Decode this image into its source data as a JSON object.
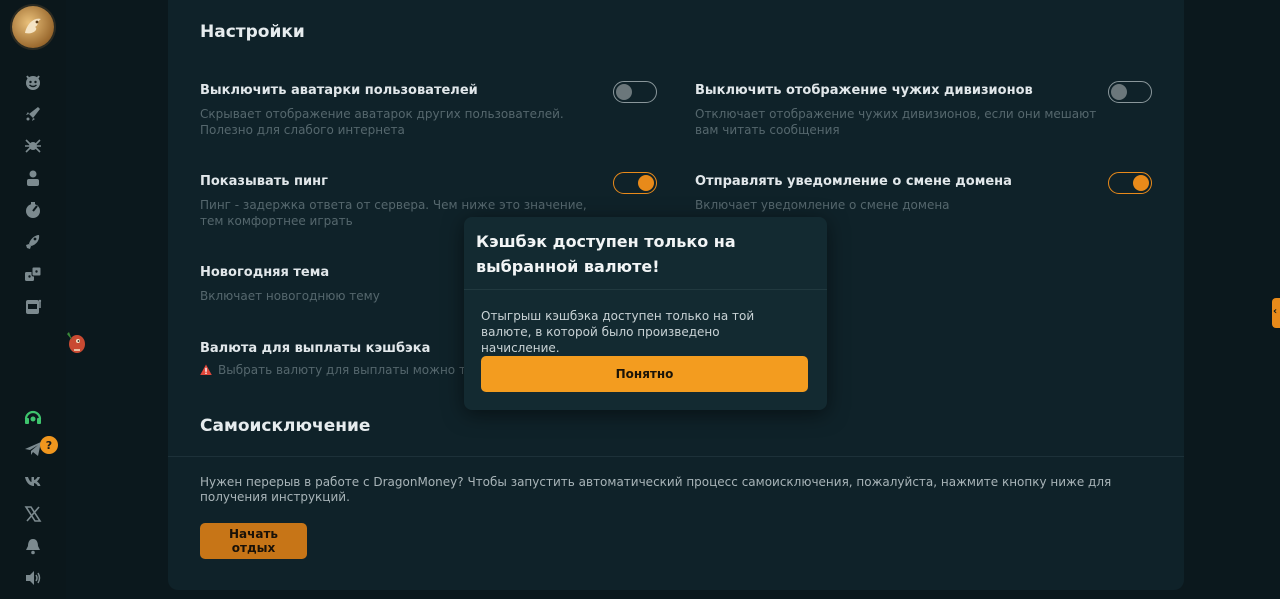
{
  "settings": {
    "title": "Настройки",
    "items": [
      {
        "title": "Выключить аватарки пользователей",
        "desc": "Скрывает отображение аватарок других пользователей. Полезно для слабого интернета",
        "state": "off"
      },
      {
        "title": "Выключить отображение чужих дивизионов",
        "desc": "Отключает отображение чужих дивизионов, если они мешают вам читать сообщения",
        "state": "off"
      },
      {
        "title": "Показывать пинг",
        "desc": "Пинг - задержка ответа от сервера. Чем ниже это значение, тем комфортнее играть",
        "state": "on"
      },
      {
        "title": "Отправлять уведомление о смене домена",
        "desc": "Включает уведомление о смене домена",
        "state": "on"
      },
      {
        "title": "Новогодняя тема",
        "desc": "Включает новогоднюю тему"
      }
    ],
    "cashback": {
      "title": "Валюта для выплаты кэшбэка",
      "warning": "Выбрать валюту для выплаты можно толь"
    }
  },
  "self_exclusion": {
    "title": "Самоисключение",
    "desc": "Нужен перерыв в работе с DragonMoney? Чтобы запустить автоматический процесс самоисключения, пожалуйста, нажмите кнопку ниже для получения инструкций.",
    "button": "Начать отдых"
  },
  "modal": {
    "title": "Кэшбэк доступен только на выбранной валюте!",
    "body": "Отыгрыш кэшбэка доступен только на той валюте, в которой было произведено начисление.",
    "button": "Понятно"
  },
  "sidebar": {
    "badge": "?",
    "icons": [
      "logo",
      "smile-icon",
      "rocket-icon",
      "spider-icon",
      "person-icon",
      "crash-icon",
      "rocket-launch-icon",
      "dice-icon",
      "slot-machine-icon",
      "mascot-icon",
      "support-headset-icon",
      "telegram-icon",
      "vk-icon",
      "x-icon",
      "bell-icon",
      "sound-icon"
    ]
  },
  "colors": {
    "accent": "#f39c1f",
    "background": "#0b181d",
    "panel": "#0f2229"
  }
}
